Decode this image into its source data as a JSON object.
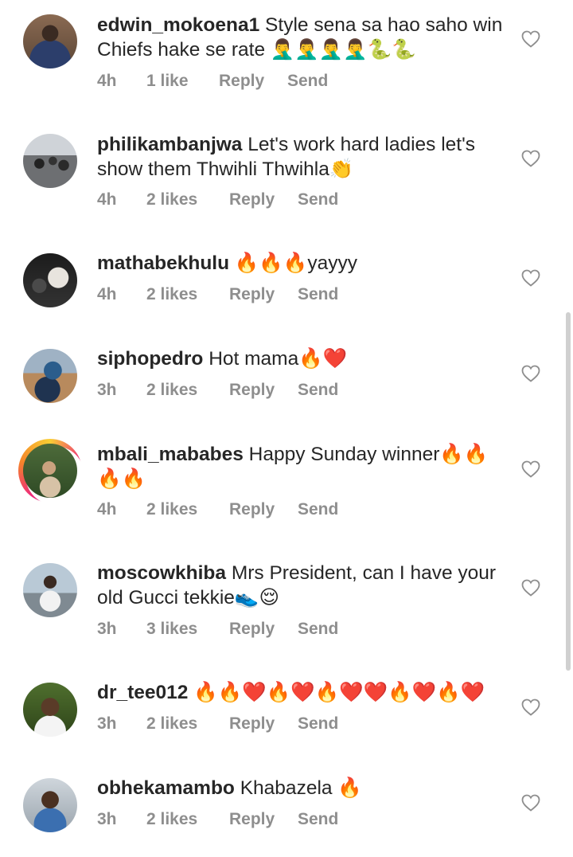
{
  "comments": [
    {
      "username": "edwin_mokoena1",
      "text": "Style sena sa hao saho win Chiefs hake se rate 🤦‍♂️🤦‍♂️🤦‍♂️🤦‍♂️🐍🐍",
      "time": "4h",
      "likes": "1 like",
      "reply": "Reply",
      "send": "Send"
    },
    {
      "username": "philikambanjwa",
      "text": "Let's work hard ladies let's show them Thwihli Thwihla👏",
      "time": "4h",
      "likes": "2 likes",
      "reply": "Reply",
      "send": "Send"
    },
    {
      "username": "mathabekhulu",
      "text": "🔥🔥🔥yayyy",
      "time": "4h",
      "likes": "2 likes",
      "reply": "Reply",
      "send": "Send"
    },
    {
      "username": "siphopedro",
      "text": "Hot mama🔥❤️",
      "time": "3h",
      "likes": "2 likes",
      "reply": "Reply",
      "send": "Send"
    },
    {
      "username": "mbali_mababes",
      "text": "Happy Sunday winner🔥🔥🔥🔥",
      "time": "4h",
      "likes": "2 likes",
      "reply": "Reply",
      "send": "Send"
    },
    {
      "username": "moscowkhiba",
      "text": "Mrs President, can I have your old Gucci tekkie👟😌",
      "time": "3h",
      "likes": "3 likes",
      "reply": "Reply",
      "send": "Send"
    },
    {
      "username": "dr_tee012",
      "text": "🔥🔥❤️🔥❤️🔥❤️❤️🔥❤️🔥❤️",
      "time": "3h",
      "likes": "2 likes",
      "reply": "Reply",
      "send": "Send"
    },
    {
      "username": "obhekamambo",
      "text": "Khabazela 🔥",
      "time": "3h",
      "likes": "2 likes",
      "reply": "Reply",
      "send": "Send"
    }
  ],
  "icons": {
    "like": "heart-outline-icon",
    "avatar": "profile-photo"
  },
  "colors": {
    "text": "#262626",
    "meta": "#8e8e8e",
    "heart": "#8e8e8e"
  }
}
